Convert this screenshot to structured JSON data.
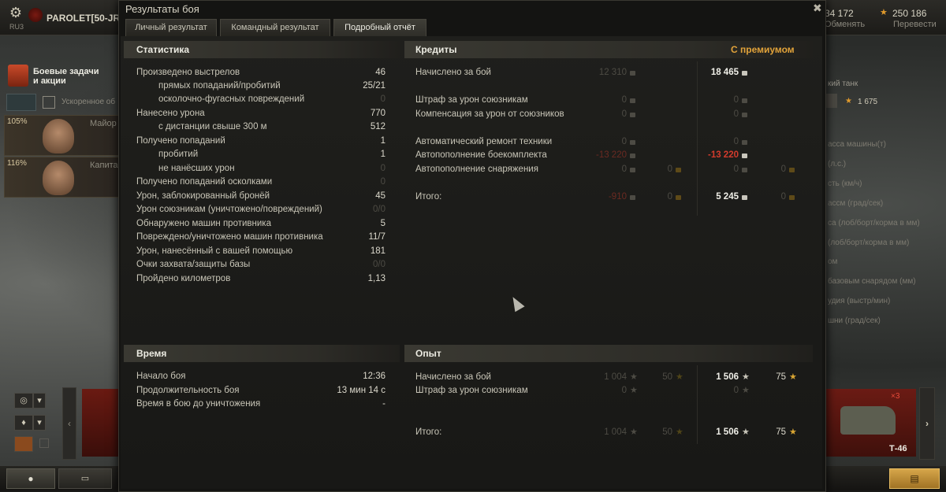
{
  "topbar": {
    "server": "RU3",
    "player": "PAROLET[50-JR]",
    "credits": "34 172",
    "exchange_label": "Обменять",
    "free_xp": "250 186",
    "convert_label": "Перевести"
  },
  "left_panel": {
    "missions_label_1": "Боевые задачи",
    "missions_label_2": "и акции",
    "accelerated": "Ускоренное об",
    "crew": [
      {
        "pct": "105%",
        "name": "Майор"
      },
      {
        "pct": "116%",
        "name": "Капитан"
      }
    ]
  },
  "right_panel": {
    "vehicle_type": "кий танк",
    "xp": "1 675",
    "specs": [
      "асса машины(т)",
      "(л.с.)",
      "сть (км/ч)",
      "ассм (град/сек)",
      "са (лоб/борт/корма в мм)",
      "(лоб/борт/корма в мм)",
      "ом",
      "базовым снарядом (мм)",
      "удия (выстр/мин)",
      "шни (град/сек)"
    ],
    "tank_name": "Т-46",
    "tank_count": "×3"
  },
  "dialog": {
    "title": "Результаты боя",
    "tabs": [
      "Личный результат",
      "Командный результат",
      "Подробный отчёт"
    ],
    "active_tab": 2,
    "stats": {
      "header": "Статистика",
      "rows": [
        {
          "label": "Произведено выстрелов",
          "value": "46",
          "indent": false,
          "dim": false
        },
        {
          "label": "прямых попаданий/пробитий",
          "value": "25/21",
          "indent": true,
          "dim": false
        },
        {
          "label": "осколочно-фугасных повреждений",
          "value": "0",
          "indent": true,
          "dim": true
        },
        {
          "label": "Нанесено урона",
          "value": "770",
          "indent": false,
          "dim": false
        },
        {
          "label": "с дистанции свыше 300 м",
          "value": "512",
          "indent": true,
          "dim": false
        },
        {
          "label": "Получено попаданий",
          "value": "1",
          "indent": false,
          "dim": false
        },
        {
          "label": "пробитий",
          "value": "1",
          "indent": true,
          "dim": false
        },
        {
          "label": "не нанёсших урон",
          "value": "0",
          "indent": true,
          "dim": true
        },
        {
          "label": "Получено попаданий осколками",
          "value": "0",
          "indent": false,
          "dim": true
        },
        {
          "label": "Урон, заблокированный бронёй",
          "value": "45",
          "indent": false,
          "dim": false
        },
        {
          "label": "Урон союзникам (уничтожено/повреждений)",
          "value": "0/0",
          "indent": false,
          "dim": true
        },
        {
          "label": "Обнаружено машин противника",
          "value": "5",
          "indent": false,
          "dim": false
        },
        {
          "label": "Повреждено/уничтожено машин противника",
          "value": "11/7",
          "indent": false,
          "dim": false
        },
        {
          "label": "Урон, нанесённый с вашей помощью",
          "value": "181",
          "indent": false,
          "dim": false
        },
        {
          "label": "Очки захвата/защиты базы",
          "value": "0/0",
          "indent": false,
          "dim": true
        },
        {
          "label": "Пройдено километров",
          "value": "1,13",
          "indent": false,
          "dim": false
        }
      ]
    },
    "credits": {
      "header": "Кредиты",
      "premium_header": "С премиумом",
      "rows": [
        {
          "label": "Начислено за бой",
          "base": "12 310",
          "base_gold": "",
          "prem": "18 465",
          "prem_gold": "",
          "prem_red": false
        },
        {
          "label": "Штраф за урон союзникам",
          "base": "0",
          "base_gold": "",
          "prem": "0",
          "prem_gold": "",
          "prem_red": false
        },
        {
          "label": "Компенсация за урон от союзников",
          "base": "0",
          "base_gold": "",
          "prem": "0",
          "prem_gold": "",
          "prem_red": false
        },
        {
          "label": "Автоматический ремонт техники",
          "base": "0",
          "base_gold": "",
          "prem": "0",
          "prem_gold": "",
          "prem_red": false
        },
        {
          "label": "Автопополнение боекомплекта",
          "base": "-13 220",
          "base_gold": "",
          "prem": "-13 220",
          "prem_gold": "",
          "prem_red": true
        },
        {
          "label": "Автопополнение снаряжения",
          "base": "0",
          "base_gold": "0",
          "prem": "0",
          "prem_gold": "0",
          "prem_red": false
        },
        {
          "label": "Итого:",
          "base": "-910",
          "base_gold": "0",
          "prem": "5 245",
          "prem_gold": "0",
          "prem_red": false
        }
      ]
    },
    "time": {
      "header": "Время",
      "rows": [
        {
          "label": "Начало боя",
          "value": "12:36"
        },
        {
          "label": "Продолжительность боя",
          "value": "13 мин 14 с"
        },
        {
          "label": "Время в бою до уничтожения",
          "value": "-"
        }
      ]
    },
    "xp": {
      "header": "Опыт",
      "rows": [
        {
          "label": "Начислено за бой",
          "base": "1 004",
          "base_free": "50",
          "prem": "1 506",
          "prem_free": "75"
        },
        {
          "label": "Штраф за урон союзникам",
          "base": "0",
          "base_free": "",
          "prem": "0",
          "prem_free": ""
        },
        {
          "label": "Итого:",
          "base": "1 004",
          "base_free": "50",
          "prem": "1 506",
          "prem_free": "75"
        }
      ]
    }
  }
}
